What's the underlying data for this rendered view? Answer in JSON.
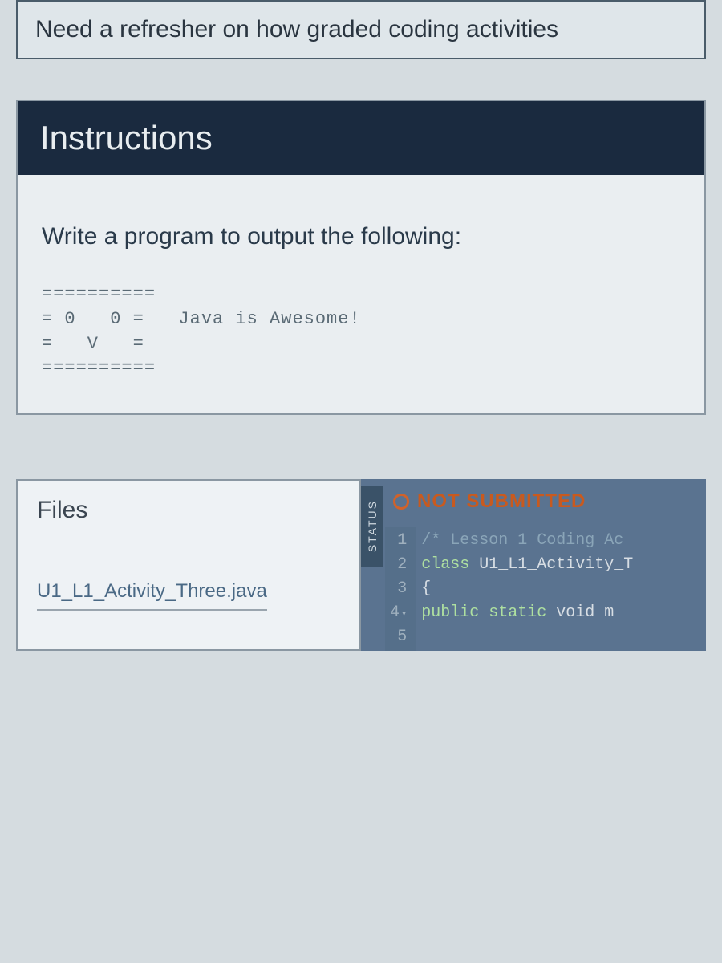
{
  "banner": {
    "text": "Need a refresher on how graded coding activities"
  },
  "instructions": {
    "heading": "Instructions",
    "prompt": "Write a program to output the following:",
    "sample_lines": [
      "==========",
      "= 0   0 =   Java is Awesome!",
      "=   V   =",
      "=========="
    ]
  },
  "files": {
    "heading": "Files",
    "items": [
      {
        "name": "U1_L1_Activity_Three.java"
      }
    ]
  },
  "editor": {
    "status_tab": "STATUS",
    "status_text": "NOT SUBMITTED",
    "gutter": [
      "1",
      "2",
      "3",
      "4",
      "5"
    ],
    "code": {
      "line1_comment": "/* Lesson 1 Coding Ac",
      "line2": "",
      "line3_keyword": "class",
      "line3_rest": " U1_L1_Activity_T",
      "line4": "{",
      "line5_keyword": "public static",
      "line5_rest": " void m"
    }
  }
}
